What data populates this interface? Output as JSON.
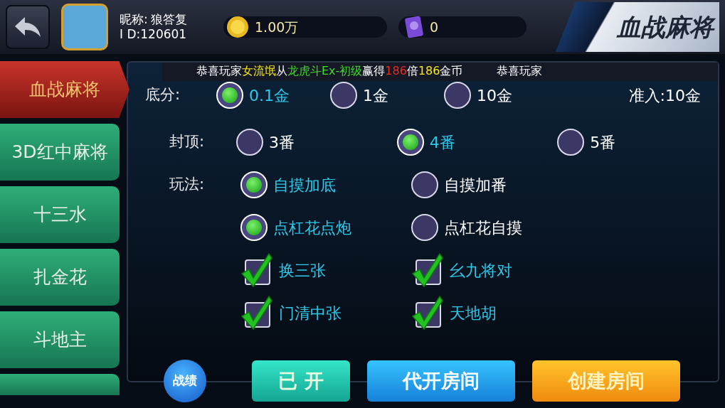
{
  "header": {
    "nickname_label": "昵称:",
    "nickname": "狼答复",
    "id_label": "I D:",
    "id": "120601",
    "gold": "1.00万",
    "cards": "0",
    "game_title": "血战麻将"
  },
  "ticker": [
    [
      {
        "text": "恭喜玩家",
        "color": "#ffffff"
      },
      {
        "text": "女流氓",
        "color": "#f5e51c"
      },
      {
        "text": "从",
        "color": "#ffffff"
      },
      {
        "text": "龙虎斗Ex-初级",
        "color": "#3fdc2a"
      },
      {
        "text": "赢得",
        "color": "#ffffff"
      },
      {
        "text": "186",
        "color": "#f02a1e"
      },
      {
        "text": "倍",
        "color": "#ffffff"
      },
      {
        "text": "186",
        "color": "#f5e51c"
      },
      {
        "text": "金币",
        "color": "#ffffff"
      }
    ],
    [
      {
        "text": "恭喜玩家",
        "color": "#ffffff"
      }
    ]
  ],
  "sidebar": [
    {
      "label": "血战麻将",
      "selected": true
    },
    {
      "label": "3D红中麻将",
      "selected": false
    },
    {
      "label": "十三水",
      "selected": false
    },
    {
      "label": "扎金花",
      "selected": false
    },
    {
      "label": "斗地主",
      "selected": false
    }
  ],
  "base_score": {
    "label": "底分:",
    "options": [
      {
        "label": "0.1金",
        "selected": true
      },
      {
        "label": "1金",
        "selected": false
      },
      {
        "label": "10金",
        "selected": false
      }
    ],
    "entry": "准入:10金"
  },
  "rules": [
    {
      "label": "封顶:",
      "options": [
        {
          "kind": "radio",
          "label": "3番",
          "selected": false
        },
        {
          "kind": "radio",
          "label": "4番",
          "selected": true
        },
        {
          "kind": "radio",
          "label": "5番",
          "selected": false
        }
      ]
    },
    {
      "label": "玩法:",
      "options": [
        {
          "kind": "radio",
          "label": "自摸加底",
          "selected": true
        },
        {
          "kind": "radio",
          "label": "自摸加番",
          "selected": false
        }
      ]
    },
    {
      "options": [
        {
          "kind": "radio",
          "label": "点杠花点炮",
          "selected": true
        },
        {
          "kind": "radio",
          "label": "点杠花自摸",
          "selected": false
        }
      ]
    },
    {
      "options": [
        {
          "kind": "checkbox",
          "label": "换三张",
          "checked": true
        },
        {
          "kind": "checkbox",
          "label": "幺九将对",
          "checked": true
        }
      ]
    },
    {
      "options": [
        {
          "kind": "checkbox",
          "label": "门清中张",
          "checked": true
        },
        {
          "kind": "checkbox",
          "label": "天地胡",
          "checked": true
        }
      ]
    }
  ],
  "buttons": [
    {
      "kind": "round",
      "label": "战绩"
    },
    {
      "kind": "teal",
      "label": "已 开"
    },
    {
      "kind": "blue",
      "label": "代开房间"
    },
    {
      "kind": "orange",
      "label": "创建房间"
    }
  ]
}
